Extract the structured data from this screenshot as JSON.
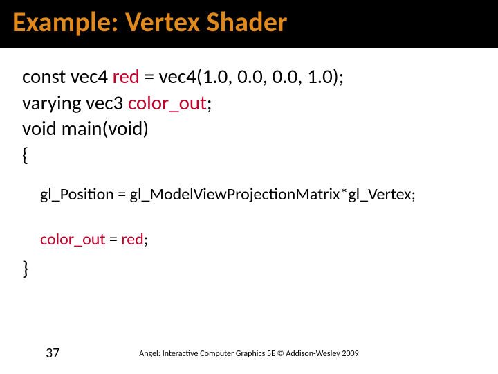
{
  "title": "Example: Vertex Shader",
  "code": {
    "l1_pre": "const vec4 ",
    "l1_var": "red",
    "l1_post": " = vec4(1.0, 0.0, 0.0, 1.0);",
    "l2_pre": "varying vec3 ",
    "l2_var": "color_out",
    "l2_post": ";",
    "l3": "void main(void)",
    "l4": "{",
    "l5": "gl_Position = gl_ModelViewProjectionMatrix*gl_Vertex;",
    "l6_var": "color_out",
    "l6_mid": " = ",
    "l6_var2": "red",
    "l6_post": ";",
    "l7": "}"
  },
  "footer": {
    "page": "37",
    "credit": "Angel: Interactive Computer Graphics 5E © Addison-Wesley 2009"
  }
}
